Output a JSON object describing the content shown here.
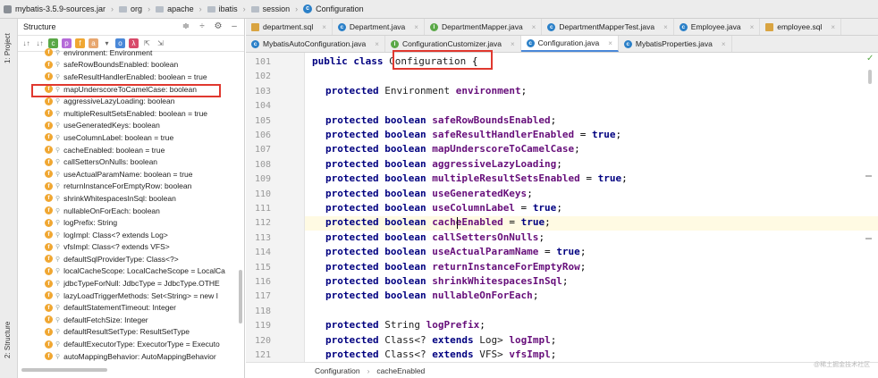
{
  "breadcrumb": [
    "mybatis-3.5.9-sources.jar",
    "org",
    "apache",
    "ibatis",
    "session",
    "Configuration"
  ],
  "left_strip": {
    "project_label": "1: Project",
    "structure_label": "2: Structure",
    "favorites_label": "rites"
  },
  "structure": {
    "title": "Structure",
    "items": [
      "environment: Environment",
      "safeRowBoundsEnabled: boolean",
      "safeResultHandlerEnabled: boolean = true",
      "mapUnderscoreToCamelCase: boolean",
      "aggressiveLazyLoading: boolean",
      "multipleResultSetsEnabled: boolean = true",
      "useGeneratedKeys: boolean",
      "useColumnLabel: boolean = true",
      "cacheEnabled: boolean = true",
      "callSettersOnNulls: boolean",
      "useActualParamName: boolean = true",
      "returnInstanceForEmptyRow: boolean",
      "shrinkWhitespacesInSql: boolean",
      "nullableOnForEach: boolean",
      "logPrefix: String",
      "logImpl: Class<? extends Log>",
      "vfsImpl: Class<? extends VFS>",
      "defaultSqlProviderType: Class<?>",
      "localCacheScope: LocalCacheScope = LocalCa",
      "jdbcTypeForNull: JdbcType = JdbcType.OTHE",
      "lazyLoadTriggerMethods: Set<String> = new I",
      "defaultStatementTimeout: Integer",
      "defaultFetchSize: Integer",
      "defaultResultSetType: ResultSetType",
      "defaultExecutorType: ExecutorType = Executo",
      "autoMappingBehavior: AutoMappingBehavior"
    ],
    "highlighted_item": "mapUnderscoreToCamelCase: boolean"
  },
  "tabs_row1": [
    {
      "label": "department.sql",
      "icon": "sql-file-icon"
    },
    {
      "label": "Department.java",
      "icon": "class-icon"
    },
    {
      "label": "DepartmentMapper.java",
      "icon": "interface-icon"
    },
    {
      "label": "DepartmentMapperTest.java",
      "icon": "test-class-icon"
    },
    {
      "label": "Employee.java",
      "icon": "class-icon"
    },
    {
      "label": "employee.sql",
      "icon": "sql-file-icon"
    }
  ],
  "tabs_row2": [
    {
      "label": "MybatisAutoConfiguration.java",
      "icon": "class-icon"
    },
    {
      "label": "ConfigurationCustomizer.java",
      "icon": "interface-icon"
    },
    {
      "label": "Configuration.java",
      "icon": "class-icon",
      "active": true
    },
    {
      "label": "MybatisProperties.java",
      "icon": "class-icon"
    }
  ],
  "code": {
    "lines": [
      {
        "n": "101",
        "t": "class-decl"
      },
      {
        "n": "102"
      },
      {
        "n": "103",
        "kw": "protected",
        "type": "Environment",
        "name": "environment",
        "tail": ";"
      },
      {
        "n": "104"
      },
      {
        "n": "105",
        "kw": "protected boolean",
        "name": "safeRowBoundsEnabled",
        "tail": ";"
      },
      {
        "n": "106",
        "kw": "protected boolean",
        "name": "safeResultHandlerEnabled",
        "tail": " = ",
        "val": "true",
        "end": ";"
      },
      {
        "n": "107",
        "kw": "protected boolean",
        "name": "mapUnderscoreToCamelCase",
        "tail": ";"
      },
      {
        "n": "108",
        "kw": "protected boolean",
        "name": "aggressiveLazyLoading",
        "tail": ";"
      },
      {
        "n": "109",
        "kw": "protected boolean",
        "name": "multipleResultSetsEnabled",
        "tail": " = ",
        "val": "true",
        "end": ";"
      },
      {
        "n": "110",
        "kw": "protected boolean",
        "name": "useGeneratedKeys",
        "tail": ";"
      },
      {
        "n": "111",
        "kw": "protected boolean",
        "name": "useColumnLabel",
        "tail": " = ",
        "val": "true",
        "end": ";"
      },
      {
        "n": "112",
        "kw": "protected boolean",
        "name": "cacheEnabled",
        "tail": " = ",
        "val": "true",
        "end": ";"
      },
      {
        "n": "113",
        "kw": "protected boolean",
        "name": "callSettersOnNulls",
        "tail": ";"
      },
      {
        "n": "114",
        "kw": "protected boolean",
        "name": "useActualParamName",
        "tail": " = ",
        "val": "true",
        "end": ";"
      },
      {
        "n": "115",
        "kw": "protected boolean",
        "name": "returnInstanceForEmptyRow",
        "tail": ";"
      },
      {
        "n": "116",
        "kw": "protected boolean",
        "name": "shrinkWhitespacesInSql",
        "tail": ";"
      },
      {
        "n": "117",
        "kw": "protected boolean",
        "name": "nullableOnForEach",
        "tail": ";"
      },
      {
        "n": "118"
      },
      {
        "n": "119",
        "kw": "protected",
        "type": "String",
        "name": "logPrefix",
        "tail": ";"
      },
      {
        "n": "120",
        "kw": "protected",
        "type": "Class<? ",
        "ext": "extends",
        "type2": " Log> ",
        "name": "logImpl",
        "tail": ";"
      },
      {
        "n": "121",
        "kw": "protected",
        "type": "Class<? ",
        "ext": "extends",
        "type2": " VFS> ",
        "name": "vfsImpl",
        "tail": ";"
      }
    ],
    "class_decl": {
      "kw": "public class",
      "name": "Configuration",
      "tail": " {"
    },
    "current_line": "112"
  },
  "status": {
    "left": "Configuration",
    "right": "cacheEnabled"
  },
  "watermark": "@稀土掘金技术社区",
  "colors": {
    "keyword": "#000080",
    "field": "#660e7a",
    "highlight": "#e0382f",
    "current_line": "#fffae3"
  }
}
